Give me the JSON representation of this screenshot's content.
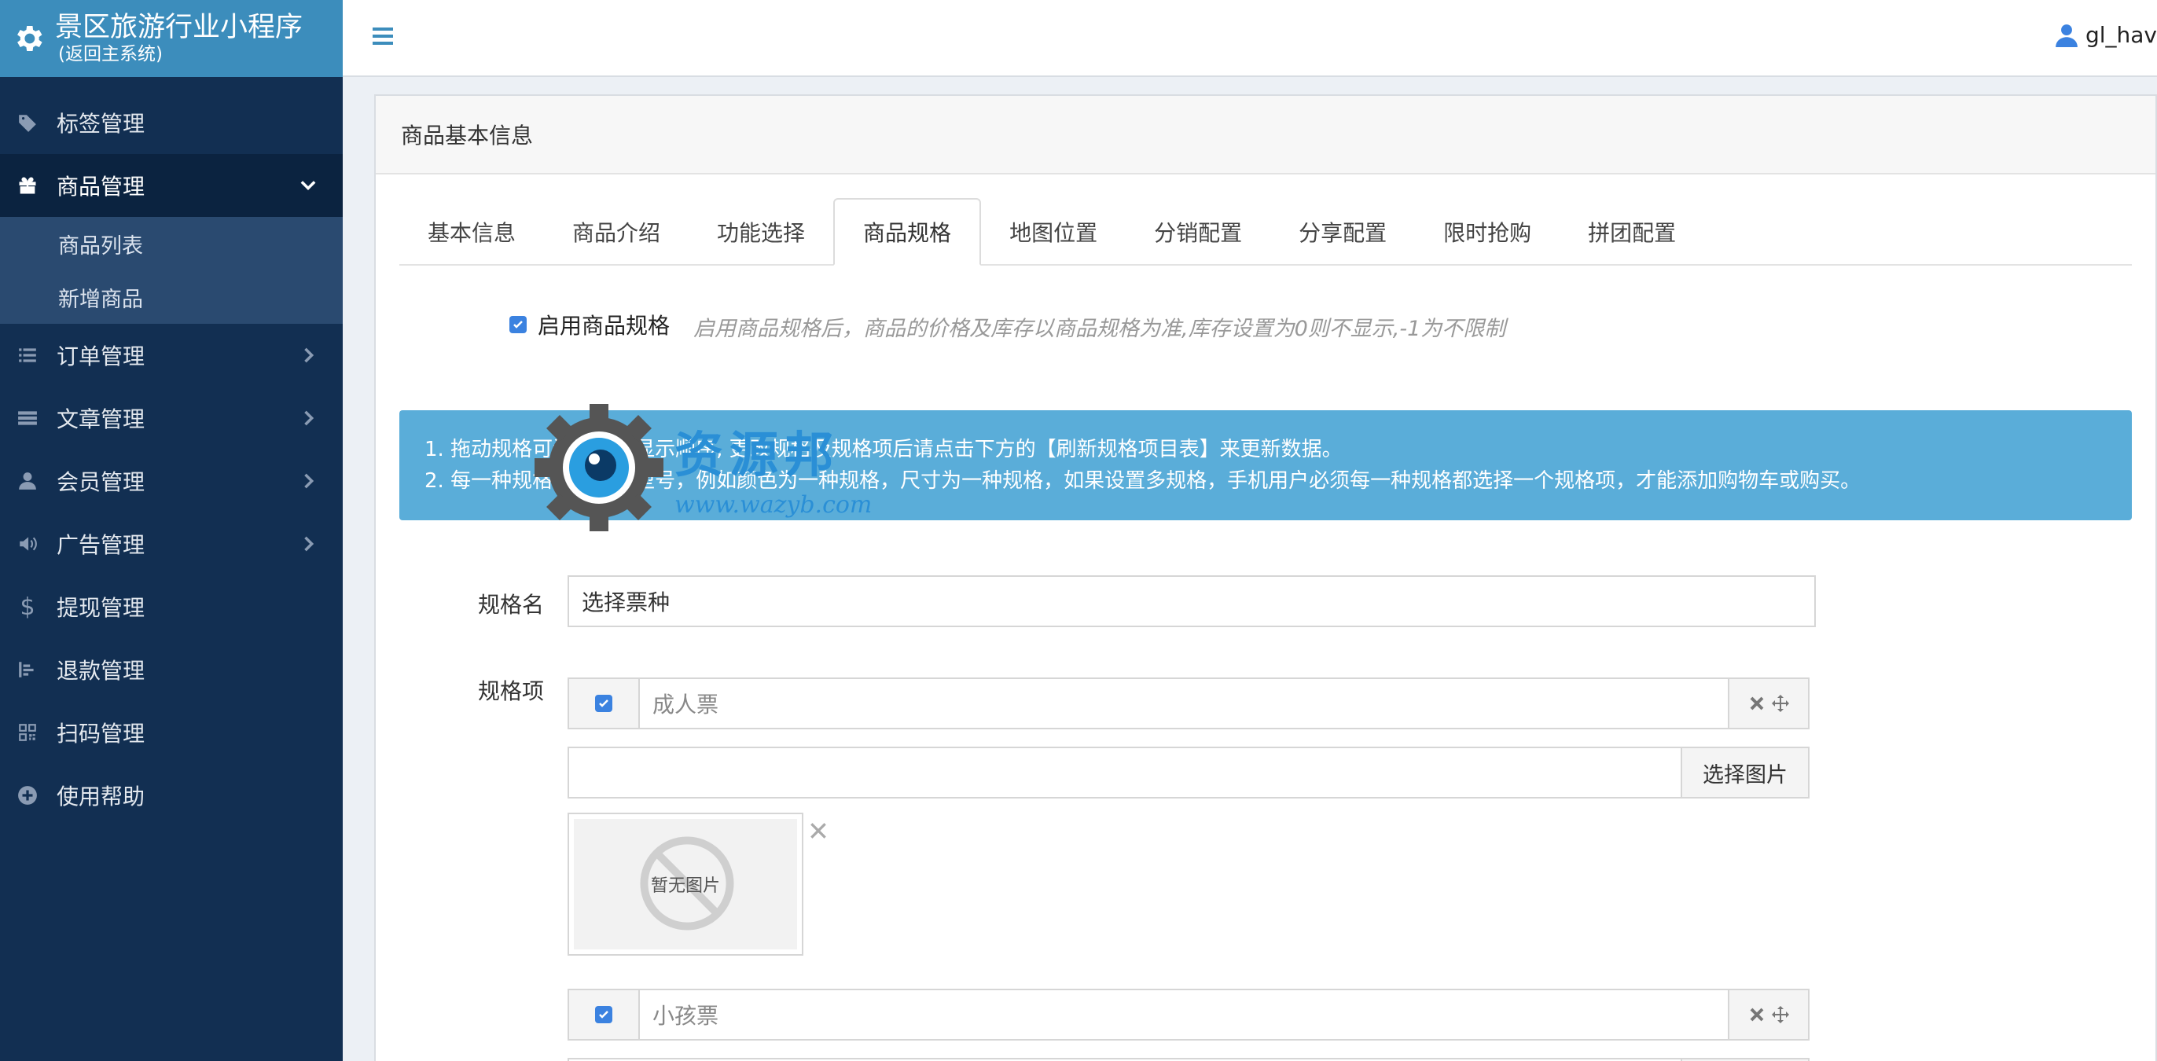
{
  "sidebar": {
    "brand_title": "景区旅游行业小程序",
    "brand_subtitle": "(返回主系统)",
    "items": [
      {
        "label": "标签管理",
        "icon": "tag-icon"
      },
      {
        "label": "商品管理",
        "icon": "gift-icon",
        "expanded": true
      },
      {
        "label": "订单管理",
        "icon": "list-icon"
      },
      {
        "label": "文章管理",
        "icon": "article-icon"
      },
      {
        "label": "会员管理",
        "icon": "user-icon"
      },
      {
        "label": "广告管理",
        "icon": "megaphone-icon"
      },
      {
        "label": "提现管理",
        "icon": "dollar-icon"
      },
      {
        "label": "退款管理",
        "icon": "refund-icon"
      },
      {
        "label": "扫码管理",
        "icon": "qrcode-icon"
      },
      {
        "label": "使用帮助",
        "icon": "help-icon"
      }
    ],
    "submenu": [
      "商品列表",
      "新增商品"
    ]
  },
  "header": {
    "username": "gl_hav"
  },
  "box": {
    "title": "商品基本信息"
  },
  "tabs": [
    "基本信息",
    "商品介绍",
    "功能选择",
    "商品规格",
    "地图位置",
    "分销配置",
    "分享配置",
    "限时抢购",
    "拼团配置"
  ],
  "active_tab": "商品规格",
  "spec": {
    "enable_label": "启用商品规格",
    "enable_hint": "启用商品规格后，商品的价格及库存以商品规格为准,库存设置为0则不显示,-1为不限制",
    "alert_lines": [
      "1. 拖动规格可调整规格显示顺序, 更改规格及规格项后请点击下方的【刷新规格项目表】来更新数据。",
      "2. 每一种规格代表不同型号，例如颜色为一种规格，尺寸为一种规格，如果设置多规格，手机用户必须每一种规格都选择一个规格项，才能添加购物车或购买。"
    ],
    "name_label": "规格名",
    "name_value": "选择票种",
    "items_label": "规格项",
    "items": [
      {
        "value": "成人票"
      },
      {
        "value": "小孩票"
      }
    ],
    "choose_image_label": "选择图片",
    "no_image_label": "暂无图片"
  },
  "watermark": {
    "title": "资源邦",
    "url": "www.wazyb.com"
  },
  "colors": {
    "sidebar_bg": "#122f52",
    "brand_bg": "#3c8dbc",
    "alert_bg": "#5aadd9",
    "checkbox": "#3b82e0"
  }
}
